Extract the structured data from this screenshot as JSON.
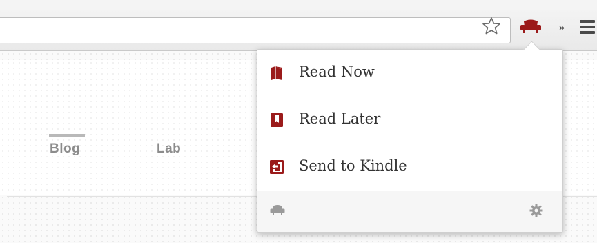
{
  "browser": {
    "toolbar": {
      "bookmark_icon": "star-outline-icon",
      "extension_icon": "armchair-icon",
      "overflow_label": "»",
      "menu_icon": "hamburger-menu-icon"
    }
  },
  "page": {
    "nav": {
      "items": [
        {
          "label": "Blog",
          "active": true
        },
        {
          "label": "Lab",
          "active": false
        }
      ]
    }
  },
  "popup": {
    "items": [
      {
        "label": "Read Now",
        "icon": "book-icon"
      },
      {
        "label": "Read Later",
        "icon": "bookmark-icon"
      },
      {
        "label": "Send to Kindle",
        "icon": "send-arrow-icon"
      }
    ],
    "footer": {
      "left_icon": "armchair-icon",
      "right_icon": "gear-icon"
    }
  },
  "colors": {
    "accent": "#9b1b1b",
    "footer_icon": "#9a9a9a"
  }
}
